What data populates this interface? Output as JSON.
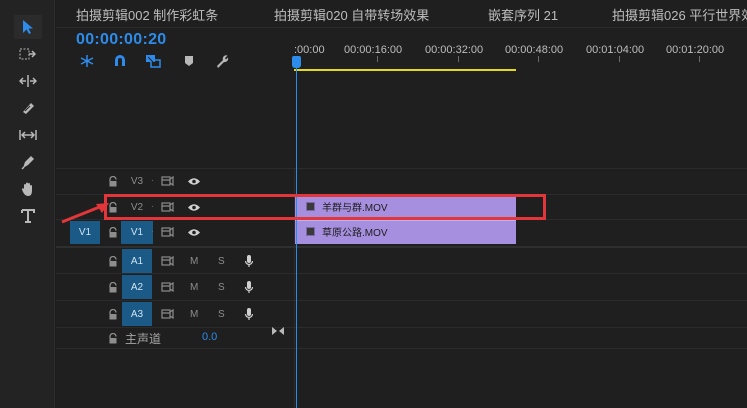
{
  "sequence_tabs": [
    "拍摄剪辑002 制作彩虹条",
    "拍摄剪辑020 自带转场效果",
    "嵌套序列 21",
    "拍摄剪辑026 平行世界效"
  ],
  "timecode": "00:00:00:20",
  "ruler_labels": [
    ":00:00",
    "00:00:16:00",
    "00:00:32:00",
    "00:00:48:00",
    "00:01:04:00",
    "00:01:20:00"
  ],
  "tracks": {
    "v3": {
      "label": "V3"
    },
    "v2": {
      "label": "V2"
    },
    "v1": {
      "label": "V1",
      "source": "V1"
    },
    "a1": {
      "label": "A1",
      "m": "M",
      "s": "S"
    },
    "a2": {
      "label": "A2",
      "m": "M",
      "s": "S"
    },
    "a3": {
      "label": "A3",
      "m": "M",
      "s": "S"
    },
    "master": {
      "label": "主声道",
      "volume": "0.0"
    }
  },
  "clips": {
    "v2_clip": "羊群与群.MOV",
    "v1_clip": "草原公路.MOV"
  },
  "colors": {
    "accent": "#2d8ceb",
    "clip": "#a68fdf",
    "work_area": "#e3d91d",
    "annotation": "#e3363a"
  }
}
